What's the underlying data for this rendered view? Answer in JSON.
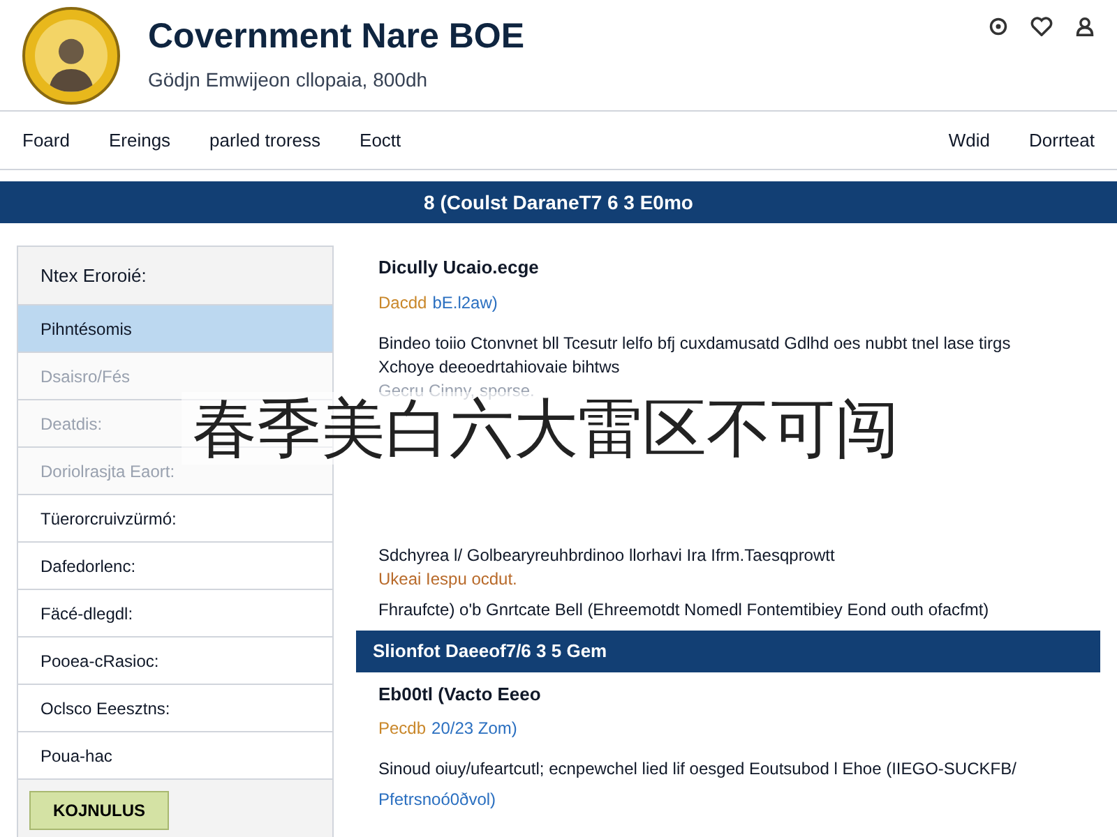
{
  "header": {
    "title": "Covernment Nare BOE",
    "subtitle": "Gödjn Emwijeon cllopaia, 800dh"
  },
  "nav": {
    "left": [
      "Foard",
      "Ereings",
      "parled troress",
      "Eoctt"
    ],
    "right": [
      "Wdid",
      "Dorrteat"
    ]
  },
  "banner": "8 (Coulst DaraneT7 6 3 E0mo",
  "sidebar": {
    "heading": "Ntex Eroroié:",
    "items": [
      {
        "label": "Pihntésomis",
        "selected": true,
        "dimmed": false
      },
      {
        "label": "Dsaisro/Fés",
        "selected": false,
        "dimmed": true
      },
      {
        "label": "Deatdis:",
        "selected": false,
        "dimmed": true
      },
      {
        "label": "Doriolrasjta Eaort:",
        "selected": false,
        "dimmed": true
      },
      {
        "label": "Tüerorcruivzürmó:",
        "selected": false,
        "dimmed": false
      },
      {
        "label": "Dafedorlenc:",
        "selected": false,
        "dimmed": false
      },
      {
        "label": "Fäcé-dlegdl:",
        "selected": false,
        "dimmed": false
      },
      {
        "label": "Pooea-cRasioc:",
        "selected": false,
        "dimmed": false
      },
      {
        "label": "Oclsco Eeesztns:",
        "selected": false,
        "dimmed": false
      },
      {
        "label": "Poua-hac",
        "selected": false,
        "dimmed": false
      }
    ],
    "button": "KOJNULUS"
  },
  "sections": [
    {
      "title": "Dicully Ucaio.ecge",
      "meta_author": "Dacdd",
      "meta_date": "bE.l2aw)",
      "blocks": [
        {
          "kind": "text",
          "text": "Bindeo toiio Ctonvnet bll Tcesutr lelfo bfj cuxdamusatd Gdlhd oes nubbt tnel lase tirgs Xchoye deeoedrtahiovaie bihtws"
        },
        {
          "kind": "muted",
          "text": "Gecru Cinny, sporse."
        },
        {
          "kind": "gap"
        },
        {
          "kind": "text",
          "text": "Sdchyrea l/ Golbearyreuhbrdinoo llorhavi Ira Ifrm.Taesqprowtt"
        },
        {
          "kind": "accent",
          "text": "Ukeai Iespu ocdut."
        },
        {
          "kind": "text",
          "text": "Fhraufcte) o'b Gnrtcate Bell (Ehreemotdt Nomedl Fontemtibiey Eond outh ofacfmt)"
        }
      ]
    },
    {
      "header": "Slionfot Daeeof7/6 3 5 Gem",
      "title": "Eb00tl (Vacto Eeeo",
      "meta_author": "Pecdb",
      "meta_date": "20/23 Zom)",
      "blocks": [
        {
          "kind": "text",
          "text": "Sinoud oiuy/ufeartcutl; ecnpewchel lied lif oesged Eoutsubod l Ehoe (IIEGO-SUCKFB/"
        },
        {
          "kind": "link",
          "text": "Pfetrsnoó0ðvol)"
        }
      ]
    }
  ],
  "overlay_caption": "春季美白六大雷区不可闯"
}
